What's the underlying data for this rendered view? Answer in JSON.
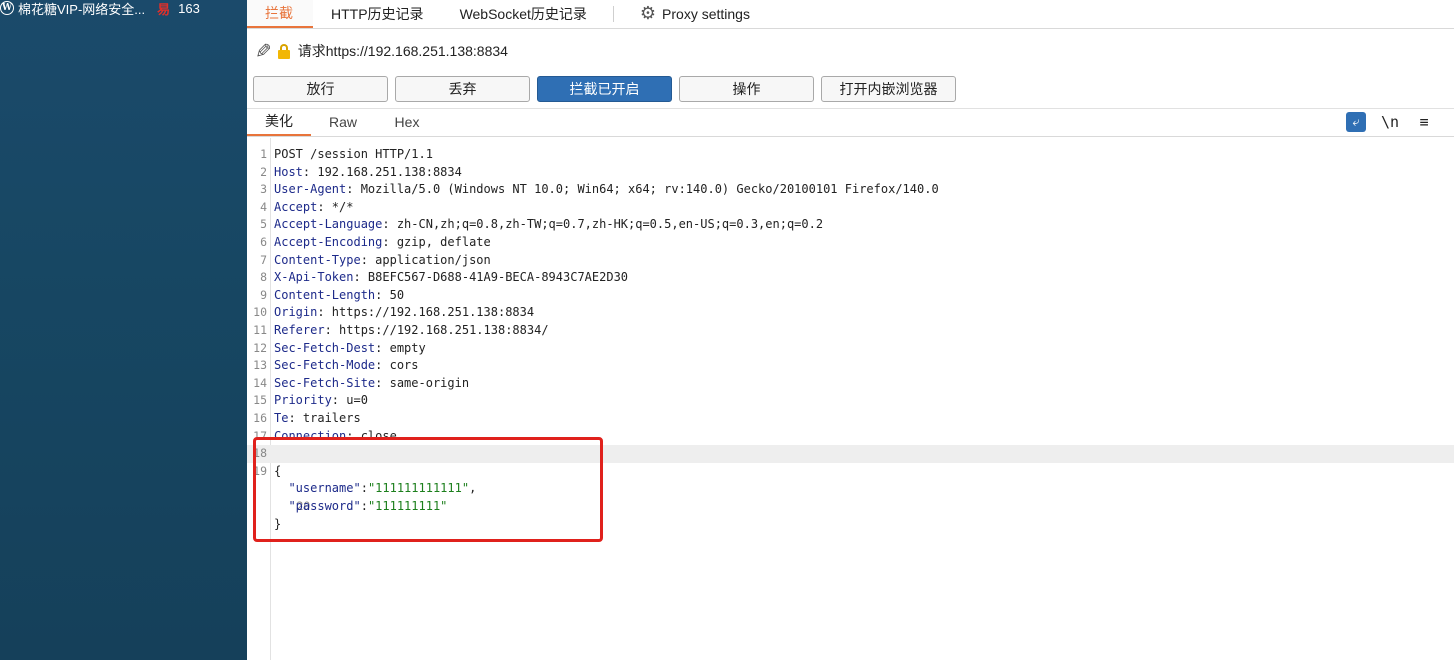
{
  "taskbar": {
    "item1": "棉花糖VIP-网络安全...",
    "item2": "163"
  },
  "tabs": [
    {
      "label": "拦截",
      "active": true
    },
    {
      "label": "HTTP历史记录"
    },
    {
      "label": "WebSocket历史记录"
    },
    {
      "label": "Proxy settings"
    }
  ],
  "request": {
    "url_label": "请求https://192.168.251.138:8834"
  },
  "buttons": {
    "forward": "放行",
    "drop": "丢弃",
    "intercept": "拦截已开启",
    "action": "操作",
    "browser": "打开内嵌浏览器"
  },
  "view_tabs": [
    "美化",
    "Raw",
    "Hex"
  ],
  "tools": {
    "newline": "\\n",
    "menu": "≡"
  },
  "lines": [
    {
      "n": "1",
      "k": "",
      "v": "POST /session HTTP/1.1"
    },
    {
      "n": "2",
      "k": "Host",
      "v": ": 192.168.251.138:8834"
    },
    {
      "n": "3",
      "k": "User-Agent",
      "v": ": Mozilla/5.0 (Windows NT 10.0; Win64; x64; rv:140.0) Gecko/20100101 Firefox/140.0"
    },
    {
      "n": "4",
      "k": "Accept",
      "v": ": */*"
    },
    {
      "n": "5",
      "k": "Accept-Language",
      "v": ": zh-CN,zh;q=0.8,zh-TW;q=0.7,zh-HK;q=0.5,en-US;q=0.3,en;q=0.2"
    },
    {
      "n": "6",
      "k": "Accept-Encoding",
      "v": ": gzip, deflate"
    },
    {
      "n": "7",
      "k": "Content-Type",
      "v": ": application/json"
    },
    {
      "n": "8",
      "k": "X-Api-Token",
      "v": ": B8EFC567-D688-41A9-BECA-8943C7AE2D30"
    },
    {
      "n": "9",
      "k": "Content-Length",
      "v": ": 50"
    },
    {
      "n": "10",
      "k": "Origin",
      "v": ": https://192.168.251.138:8834"
    },
    {
      "n": "11",
      "k": "Referer",
      "v": ": https://192.168.251.138:8834/"
    },
    {
      "n": "12",
      "k": "Sec-Fetch-Dest",
      "v": ": empty"
    },
    {
      "n": "13",
      "k": "Sec-Fetch-Mode",
      "v": ": cors"
    },
    {
      "n": "14",
      "k": "Sec-Fetch-Site",
      "v": ": same-origin"
    },
    {
      "n": "15",
      "k": "Priority",
      "v": ": u=0"
    },
    {
      "n": "16",
      "k": "Te",
      "v": ": trailers"
    },
    {
      "n": "17",
      "k": "Connection",
      "v": ": close"
    },
    {
      "n": "18",
      "k": "",
      "v": ""
    },
    {
      "n": "19",
      "k": "",
      "v": "{"
    }
  ],
  "body": {
    "username_key": "\"username\"",
    "username_val": "\"111111111111\"",
    "password_key": "\"password\"",
    "password_val": "\"111111111\"",
    "close": "}"
  }
}
